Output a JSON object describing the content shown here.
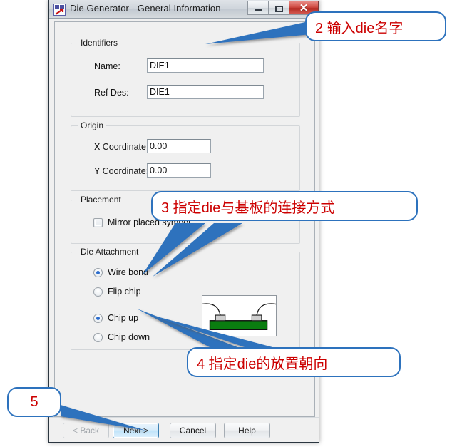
{
  "window": {
    "title": "Die Generator - General Information",
    "icon": "die-generator-icon",
    "controls": {
      "minimize": "–",
      "maximize": "□",
      "close": "✕"
    }
  },
  "groups": {
    "identifiers": {
      "label": "Identifiers",
      "fields": [
        {
          "label": "Name:",
          "value": "DIE1"
        },
        {
          "label": "Ref Des:",
          "value": "DIE1"
        }
      ]
    },
    "origin": {
      "label": "Origin",
      "fields": [
        {
          "label": "X Coordinate:",
          "value": "0.00"
        },
        {
          "label": "Y Coordinate:",
          "value": "0.00"
        }
      ]
    },
    "placement": {
      "label": "Placement",
      "checkbox": {
        "label": "Mirror placed symbol",
        "checked": false
      }
    },
    "die_attachment": {
      "label": "Die Attachment",
      "attach_options": [
        {
          "label": "Wire bond",
          "selected": true
        },
        {
          "label": "Flip chip",
          "selected": false
        }
      ],
      "orientation_options": [
        {
          "label": "Chip up",
          "selected": true
        },
        {
          "label": "Chip down",
          "selected": false
        }
      ],
      "preview_name": "wire-bond-chip-up-diagram"
    }
  },
  "footer": {
    "buttons": [
      {
        "label": "< Back",
        "state": "disabled"
      },
      {
        "label": "Next >",
        "state": "default"
      },
      {
        "label": "Cancel",
        "state": "normal"
      },
      {
        "label": "Help",
        "state": "normal"
      }
    ]
  },
  "annotations": [
    {
      "id": "a2",
      "text": "2 输入die名字"
    },
    {
      "id": "a3",
      "text": "3 指定die与基板的连接方式"
    },
    {
      "id": "a4",
      "text": "4 指定die的放置朝向"
    },
    {
      "id": "a5",
      "text": "5"
    }
  ],
  "colors": {
    "annotation_text": "#cc0000",
    "annotation_border": "#2d72bd",
    "pointer": "#2d72bd",
    "radio_dot": "#2b6ccc",
    "pcb_green": "#0a7d10",
    "window_bg": "#f0f0f0"
  }
}
